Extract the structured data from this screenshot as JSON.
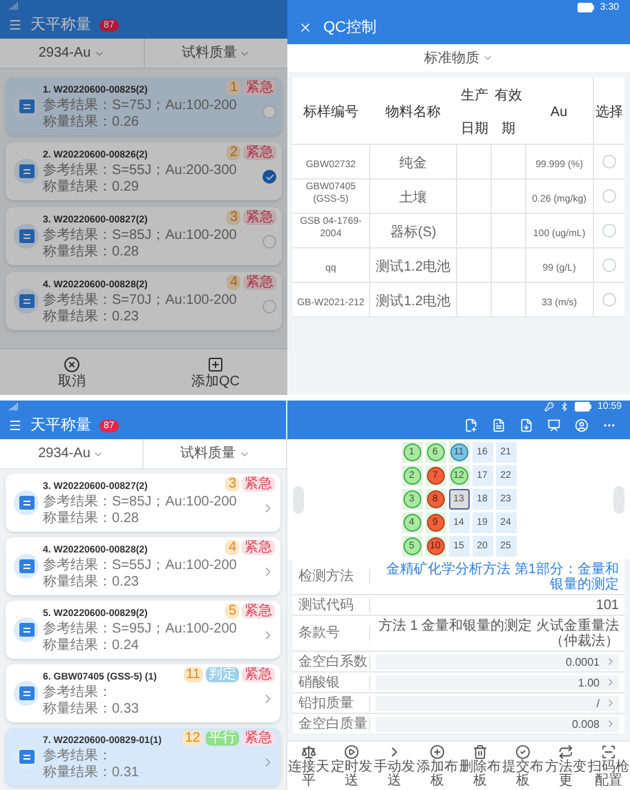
{
  "top": {
    "weighing": {
      "title": "天平称量",
      "badge": "87",
      "filters": [
        "2934-Au",
        "试料质量"
      ],
      "cards": [
        {
          "title": "1. W20220600-00825(2)",
          "ref": "参考结果：S=75J；Au:100-200",
          "weight": "称量结果：0.26",
          "tags": [
            {
              "text": "1",
              "kind": "count"
            },
            {
              "text": "紧急",
              "kind": "urgent"
            }
          ],
          "selected": true,
          "checked": false
        },
        {
          "title": "2. W20220600-00826(2)",
          "ref": "参考结果：S=55J；Au:200-300",
          "weight": "称量结果：0.29",
          "tags": [
            {
              "text": "2",
              "kind": "count"
            },
            {
              "text": "紧急",
              "kind": "urgent"
            }
          ],
          "selected": false,
          "checked": true
        },
        {
          "title": "3. W20220600-00827(2)",
          "ref": "参考结果：S=85J；Au:100-200",
          "weight": "称量结果：0.28",
          "tags": [
            {
              "text": "3",
              "kind": "count"
            },
            {
              "text": "紧急",
              "kind": "urgent"
            }
          ],
          "selected": false,
          "checked": false
        },
        {
          "title": "4. W20220600-00828(2)",
          "ref": "参考结果：S=70J；Au:100-200",
          "weight": "称量结果：0.23",
          "tags": [
            {
              "text": "4",
              "kind": "count"
            },
            {
              "text": "紧急",
              "kind": "urgent"
            }
          ],
          "selected": false,
          "checked": false
        }
      ],
      "actions": [
        "取消",
        "添加QC"
      ]
    },
    "qc_dialog": {
      "status_time": "3:30",
      "title": "QC控制",
      "category": "标准物质",
      "columns": [
        "标样编号",
        "物料名称",
        "生产日期",
        "有效期",
        "Au",
        "选择"
      ],
      "rows": [
        {
          "cells": [
            "GBW02732",
            "纯金",
            "",
            "",
            "99.999 (%)"
          ],
          "selected": false
        },
        {
          "cells": [
            "GBW07405 (GSS-5)",
            "土壤",
            "",
            "",
            "0.26 (mg/kg)"
          ],
          "selected": false
        },
        {
          "cells": [
            "GSB 04-1769-2004",
            "器标(S)",
            "",
            "",
            "100 (ug/mL)"
          ],
          "selected": false
        },
        {
          "cells": [
            "qq",
            "测试1.2电池",
            "",
            "",
            "99 (g/L)"
          ],
          "selected": false
        },
        {
          "cells": [
            "GB-W2021-212",
            "测试1.2电池",
            "",
            "",
            "33 (m/s)"
          ],
          "selected": false
        }
      ]
    }
  },
  "bottom": {
    "weighing": {
      "title": "天平称量",
      "badge": "87",
      "filters": [
        "2934-Au",
        "试料质量"
      ],
      "cards": [
        {
          "title": "3. W20220600-00827(2)",
          "ref": "参考结果：S=85J；Au:100-200",
          "weight": "称量结果：0.28",
          "tags": [
            {
              "text": "3",
              "kind": "count"
            },
            {
              "text": "紧急",
              "kind": "urgent"
            }
          ],
          "selected": false
        },
        {
          "title": "4. W20220600-00828(2)",
          "ref": "参考结果：S=55J；Au:100-200",
          "weight": "称量结果：0.23",
          "tags": [
            {
              "text": "4",
              "kind": "count"
            },
            {
              "text": "紧急",
              "kind": "urgent"
            }
          ],
          "selected": false
        },
        {
          "title": "5. W20220600-00829(2)",
          "ref": "参考结果：S=95J；Au:100-200",
          "weight": "称量结果：0.24",
          "tags": [
            {
              "text": "5",
              "kind": "count"
            },
            {
              "text": "紧急",
              "kind": "urgent"
            }
          ],
          "selected": false
        },
        {
          "title": "6. GBW07405 (GSS-5) (1)",
          "ref": "参考结果：",
          "weight": "称量结果：0.33",
          "tags": [
            {
              "text": "11",
              "kind": "count"
            },
            {
              "text": "判定",
              "kind": "judge"
            },
            {
              "text": "紧急",
              "kind": "urgent"
            }
          ],
          "selected": false
        },
        {
          "title": "7. W20220600-00829-01(1)",
          "ref": "参考结果：",
          "weight": "称量结果：0.31",
          "tags": [
            {
              "text": "12",
              "kind": "count"
            },
            {
              "text": "平行",
              "kind": "parallel"
            },
            {
              "text": "紧急",
              "kind": "urgent"
            }
          ],
          "selected": true
        }
      ]
    },
    "status_time": "10:59",
    "grid": [
      {
        "label": "1",
        "kind": "pass",
        "selected": false
      },
      {
        "label": "2",
        "kind": "pass",
        "selected": false
      },
      {
        "label": "3",
        "kind": "pass",
        "selected": false
      },
      {
        "label": "4",
        "kind": "pass",
        "selected": false
      },
      {
        "label": "5",
        "kind": "pass",
        "selected": false
      },
      {
        "label": "6",
        "kind": "pass",
        "selected": false
      },
      {
        "label": "7",
        "kind": "fail",
        "selected": false
      },
      {
        "label": "8",
        "kind": "fail",
        "selected": false
      },
      {
        "label": "9",
        "kind": "fail",
        "selected": false
      },
      {
        "label": "10",
        "kind": "fail",
        "selected": false
      },
      {
        "label": "11",
        "kind": "current",
        "selected": false
      },
      {
        "label": "12",
        "kind": "pass",
        "selected": false
      },
      {
        "label": "13",
        "kind": "empty",
        "selected": true
      },
      {
        "label": "14",
        "kind": "empty",
        "selected": false
      },
      {
        "label": "15",
        "kind": "empty",
        "selected": false
      },
      {
        "label": "16",
        "kind": "empty",
        "selected": false
      },
      {
        "label": "17",
        "kind": "empty",
        "selected": false
      },
      {
        "label": "18",
        "kind": "empty",
        "selected": false
      },
      {
        "label": "19",
        "kind": "empty",
        "selected": false
      },
      {
        "label": "20",
        "kind": "empty",
        "selected": false
      },
      {
        "label": "21",
        "kind": "empty",
        "selected": false
      },
      {
        "label": "22",
        "kind": "empty",
        "selected": false
      },
      {
        "label": "23",
        "kind": "empty",
        "selected": false
      },
      {
        "label": "24",
        "kind": "empty",
        "selected": false
      },
      {
        "label": "25",
        "kind": "empty",
        "selected": false
      }
    ],
    "form": [
      {
        "label": "检测方法",
        "value": "金精矿化学分析方法 第1部分：金量和银量的测定",
        "kind": "link"
      },
      {
        "label": "测试代码",
        "value": "101",
        "kind": "text"
      },
      {
        "label": "条款号",
        "value": "方法 1 金量和银量的测定 火试金重量法（仲裁法）",
        "kind": "text"
      },
      {
        "label": "金空白系数",
        "value": "0.0001",
        "kind": "input"
      },
      {
        "label": "硝酸银",
        "value": "1.00",
        "kind": "input"
      },
      {
        "label": "铅扣质量",
        "value": "/",
        "kind": "input"
      },
      {
        "label": "金空白质量",
        "value": "0.008",
        "kind": "input"
      }
    ],
    "toolbar": [
      "连接天平",
      "定时发送",
      "手动发送",
      "添加布板",
      "删除布板",
      "提交布板",
      "方法变更",
      "扫码枪配置"
    ]
  }
}
